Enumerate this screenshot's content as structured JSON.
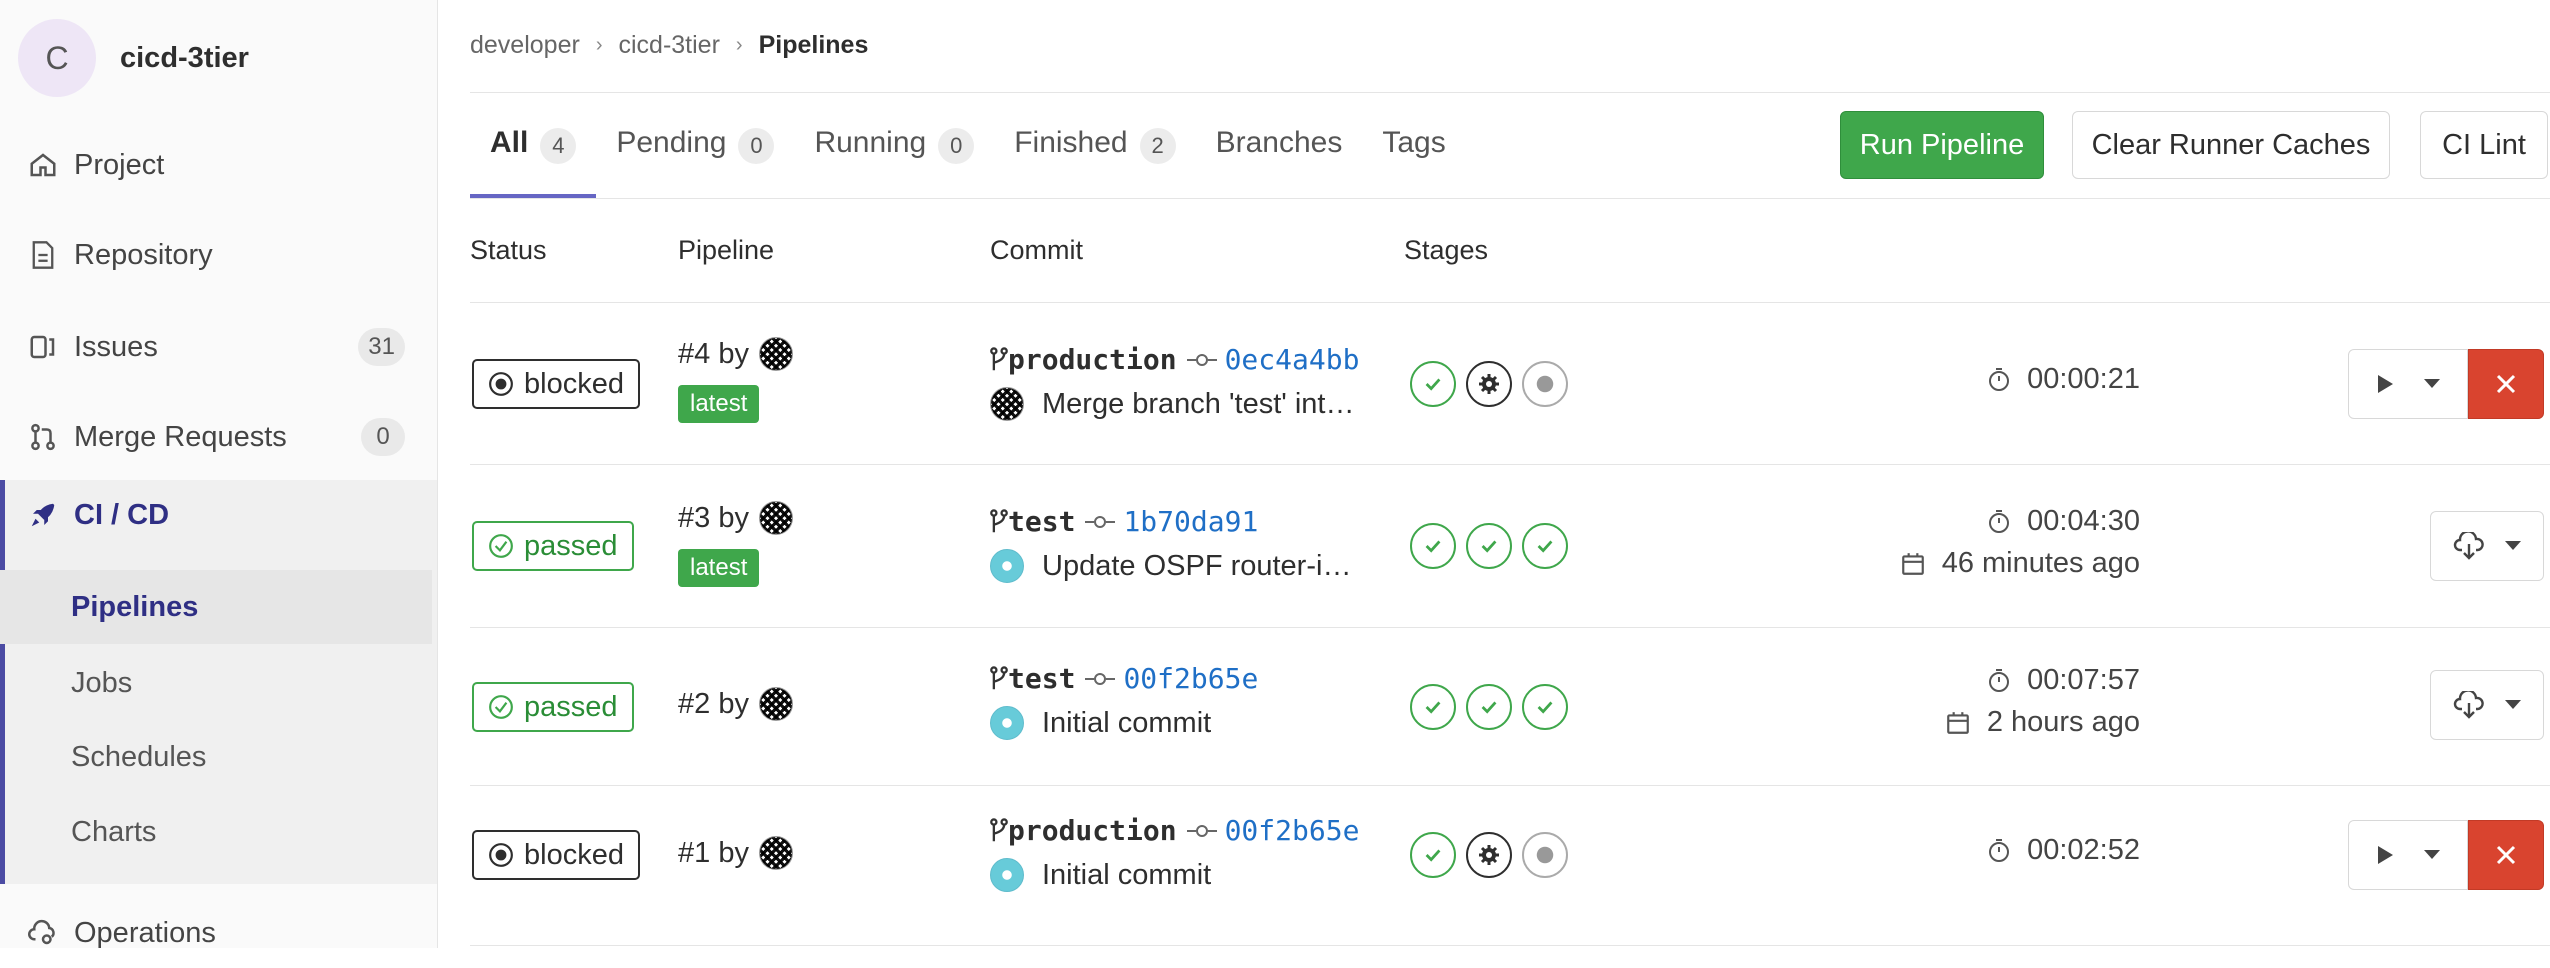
{
  "sidebar": {
    "project_initial": "C",
    "project_name": "cicd-3tier",
    "items": [
      {
        "label": "Project",
        "icon": "home-icon"
      },
      {
        "label": "Repository",
        "icon": "document-icon"
      },
      {
        "label": "Issues",
        "icon": "issues-icon",
        "count": "31"
      },
      {
        "label": "Merge Requests",
        "icon": "merge-request-icon",
        "count": "0"
      },
      {
        "label": "CI / CD",
        "icon": "rocket-icon"
      },
      {
        "label": "Operations",
        "icon": "cloud-gear-icon"
      }
    ],
    "subitems": [
      {
        "label": "Pipelines"
      },
      {
        "label": "Jobs"
      },
      {
        "label": "Schedules"
      },
      {
        "label": "Charts"
      }
    ]
  },
  "breadcrumb": [
    "developer",
    "cicd-3tier",
    "Pipelines"
  ],
  "tabs": [
    {
      "label": "All",
      "count": "4"
    },
    {
      "label": "Pending",
      "count": "0"
    },
    {
      "label": "Running",
      "count": "0"
    },
    {
      "label": "Finished",
      "count": "2"
    },
    {
      "label": "Branches"
    },
    {
      "label": "Tags"
    }
  ],
  "buttons": {
    "run_pipeline": "Run Pipeline",
    "clear_caches": "Clear Runner Caches",
    "ci_lint": "CI Lint"
  },
  "columns": [
    "Status",
    "Pipeline",
    "Commit",
    "Stages"
  ],
  "pipelines": [
    {
      "status": "blocked",
      "id": "#4 by",
      "latest": "latest",
      "branch": "production",
      "sha": "0ec4a4bb",
      "message": "Merge branch 'test' int…",
      "duration": "00:00:21",
      "finished": ""
    },
    {
      "status": "passed",
      "id": "#3 by",
      "latest": "latest",
      "branch": "test",
      "sha": "1b70da91",
      "message": "Update OSPF router-i…",
      "duration": "00:04:30",
      "finished": "46 minutes ago"
    },
    {
      "status": "passed",
      "id": "#2 by",
      "latest": "",
      "branch": "test",
      "sha": "00f2b65e",
      "message": "Initial commit",
      "duration": "00:07:57",
      "finished": "2 hours ago"
    },
    {
      "status": "blocked",
      "id": "#1 by",
      "latest": "",
      "branch": "production",
      "sha": "00f2b65e",
      "message": "Initial commit",
      "duration": "00:02:52",
      "finished": ""
    }
  ],
  "colors": {
    "accent": "#6666c4",
    "success": "#3fa74b",
    "danger": "#d9442f",
    "link": "#1f6fc6"
  }
}
